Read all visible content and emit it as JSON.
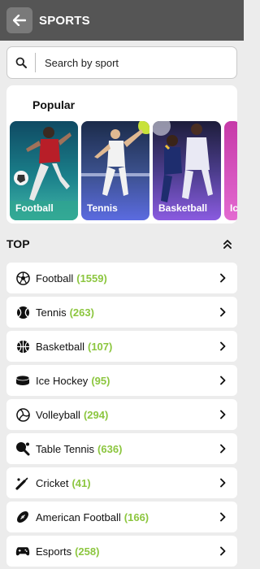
{
  "header": {
    "title": "SPORTS",
    "back_icon": "arrow-left-icon"
  },
  "search": {
    "placeholder": "Search by sport",
    "icon": "search-icon"
  },
  "popular": {
    "title": "Popular",
    "tiles": [
      {
        "label": "Football"
      },
      {
        "label": "Tennis"
      },
      {
        "label": "Basketball"
      },
      {
        "label": "Ic"
      }
    ]
  },
  "top": {
    "title": "TOP",
    "collapse_icon": "double-chevron-up-icon"
  },
  "sports": [
    {
      "name": "Football",
      "count": "(1559)",
      "icon": "soccer-ball-icon"
    },
    {
      "name": "Tennis",
      "count": "(263)",
      "icon": "tennis-ball-icon"
    },
    {
      "name": "Basketball",
      "count": "(107)",
      "icon": "basketball-icon"
    },
    {
      "name": "Ice Hockey",
      "count": "(95)",
      "icon": "hockey-puck-icon"
    },
    {
      "name": "Volleyball",
      "count": "(294)",
      "icon": "volleyball-icon"
    },
    {
      "name": "Table Tennis",
      "count": "(636)",
      "icon": "table-tennis-paddle-icon"
    },
    {
      "name": "Cricket",
      "count": "(41)",
      "icon": "cricket-bat-icon"
    },
    {
      "name": "American Football",
      "count": "(166)",
      "icon": "american-football-icon"
    },
    {
      "name": "Esports",
      "count": "(258)",
      "icon": "gamepad-icon"
    }
  ],
  "colors": {
    "header_bg": "#555555",
    "count_green": "#8cc63f",
    "page_bg": "#ececec"
  }
}
